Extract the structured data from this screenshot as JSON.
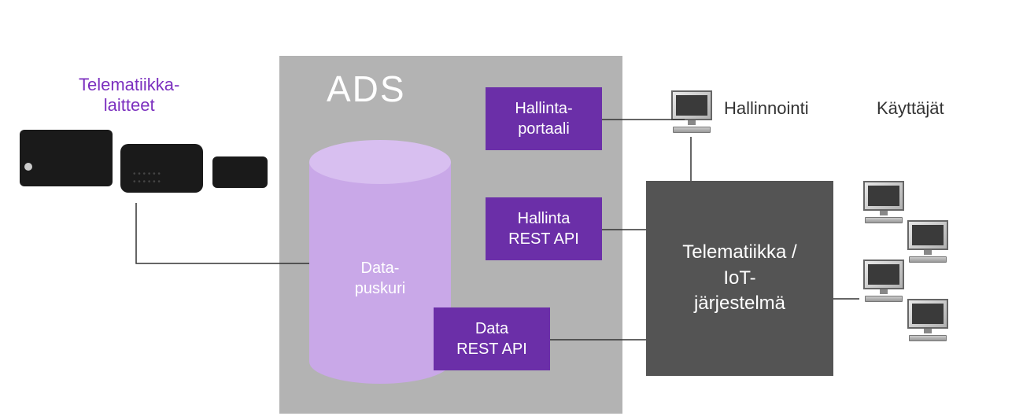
{
  "devices_label_line1": "Telematiikka-",
  "devices_label_line2": "laitteet",
  "ads": {
    "title": "ADS",
    "buffer_line1": "Data-",
    "buffer_line2": "puskuri",
    "portal_line1": "Hallinta-",
    "portal_line2": "portaali",
    "api_admin_line1": "Hallinta",
    "api_admin_line2": "REST API",
    "api_data_line1": "Data",
    "api_data_line2": "REST API"
  },
  "system_line1": "Telematiikka /",
  "system_line2": "IoT-",
  "system_line3": "järjestelmä",
  "admin_label": "Hallinnointi",
  "users_label": "Käyttäjät"
}
